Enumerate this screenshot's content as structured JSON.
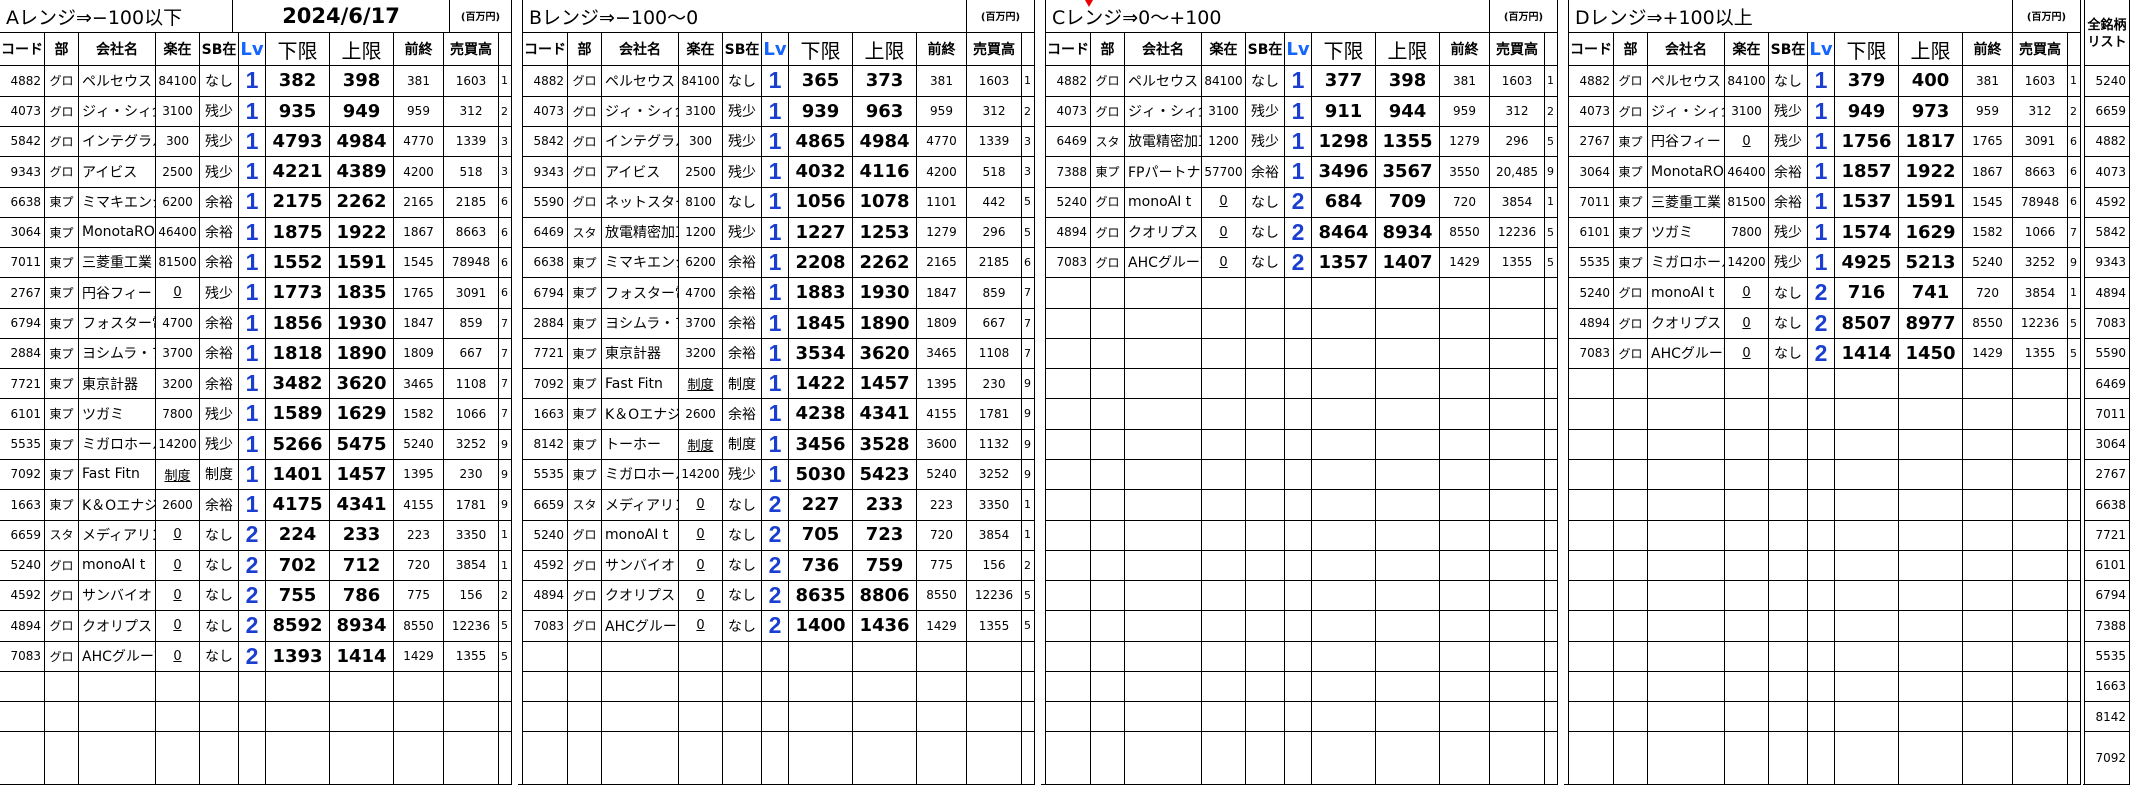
{
  "date": "2024/6/17",
  "unit_label": "(百万円)",
  "headers": {
    "code": "コード",
    "section": "部",
    "company": "会社名",
    "rakuzai": "楽在",
    "sb": "SB在",
    "lv": "Lv",
    "lower": "下限",
    "upper": "上限",
    "prev": "前終",
    "sales": "売買高"
  },
  "all_list": {
    "header": "全銘柄リスト",
    "codes": [
      "5240",
      "6659",
      "4882",
      "4073",
      "4592",
      "5842",
      "9343",
      "4894",
      "7083",
      "5590",
      "6469",
      "7011",
      "3064",
      "2767",
      "6638",
      "7721",
      "6101",
      "6794",
      "7388",
      "5535",
      "1663",
      "8142",
      "7092"
    ]
  },
  "sections": [
    {
      "title": "Aレンジ⇒−100以下",
      "rows": [
        {
          "code": "4882",
          "sec": "グロ",
          "name": "ペルセウス",
          "rak": "84100",
          "sb": "なし",
          "lv": "1",
          "lo": "382",
          "hi": "398",
          "prev": "381",
          "sales": "1603",
          "r": "1"
        },
        {
          "code": "4073",
          "sec": "グロ",
          "name": "ジィ・シィ企",
          "rak": "3100",
          "sb": "残少",
          "lv": "1",
          "lo": "935",
          "hi": "949",
          "prev": "959",
          "sales": "312",
          "r": "2"
        },
        {
          "code": "5842",
          "sec": "グロ",
          "name": "インテグラル",
          "rak": "300",
          "sb": "残少",
          "lv": "1",
          "lo": "4793",
          "hi": "4984",
          "prev": "4770",
          "sales": "1339",
          "r": "3"
        },
        {
          "code": "9343",
          "sec": "グロ",
          "name": "アイビス",
          "rak": "2500",
          "sb": "残少",
          "lv": "1",
          "lo": "4221",
          "hi": "4389",
          "prev": "4200",
          "sales": "518",
          "r": "3"
        },
        {
          "code": "6638",
          "sec": "東プ",
          "name": "ミマキエンジ",
          "rak": "6200",
          "sb": "余裕",
          "lv": "1",
          "lo": "2175",
          "hi": "2262",
          "prev": "2165",
          "sales": "2185",
          "r": "6"
        },
        {
          "code": "3064",
          "sec": "東プ",
          "name": "MonotaRO",
          "rak": "46400",
          "sb": "余裕",
          "lv": "1",
          "lo": "1875",
          "hi": "1922",
          "prev": "1867",
          "sales": "8663",
          "r": "6"
        },
        {
          "code": "7011",
          "sec": "東プ",
          "name": "三菱重工業",
          "rak": "81500",
          "sb": "余裕",
          "lv": "1",
          "lo": "1552",
          "hi": "1591",
          "prev": "1545",
          "sales": "78948",
          "r": "6"
        },
        {
          "code": "2767",
          "sec": "東プ",
          "name": "円谷フィー",
          "rak": "0",
          "u": true,
          "sb": "残少",
          "lv": "1",
          "lo": "1773",
          "hi": "1835",
          "prev": "1765",
          "sales": "3091",
          "r": "6"
        },
        {
          "code": "6794",
          "sec": "東プ",
          "name": "フォスター電",
          "rak": "4700",
          "sb": "余裕",
          "lv": "1",
          "lo": "1856",
          "hi": "1930",
          "prev": "1847",
          "sales": "859",
          "r": "7"
        },
        {
          "code": "2884",
          "sec": "東プ",
          "name": "ヨシムラ・フ",
          "rak": "3700",
          "sb": "余裕",
          "lv": "1",
          "lo": "1818",
          "hi": "1890",
          "prev": "1809",
          "sales": "667",
          "r": "7"
        },
        {
          "code": "7721",
          "sec": "東プ",
          "name": "東京計器",
          "rak": "3200",
          "sb": "余裕",
          "lv": "1",
          "lo": "3482",
          "hi": "3620",
          "prev": "3465",
          "sales": "1108",
          "r": "7"
        },
        {
          "code": "6101",
          "sec": "東プ",
          "name": "ツガミ",
          "rak": "7800",
          "sb": "残少",
          "lv": "1",
          "lo": "1589",
          "hi": "1629",
          "prev": "1582",
          "sales": "1066",
          "r": "7"
        },
        {
          "code": "5535",
          "sec": "東プ",
          "name": "ミガロホール",
          "rak": "14200",
          "sb": "残少",
          "lv": "1",
          "lo": "5266",
          "hi": "5475",
          "prev": "5240",
          "sales": "3252",
          "r": "9"
        },
        {
          "code": "7092",
          "sec": "東プ",
          "name": "Fast Fitn",
          "rak": "制度",
          "u": true,
          "sb": "制度",
          "lv": "1",
          "lo": "1401",
          "hi": "1457",
          "prev": "1395",
          "sales": "230",
          "r": "9"
        },
        {
          "code": "1663",
          "sec": "東プ",
          "name": "K＆Oエナジ",
          "rak": "2600",
          "sb": "余裕",
          "lv": "1",
          "lo": "4175",
          "hi": "4341",
          "prev": "4155",
          "sales": "1781",
          "r": "9"
        },
        {
          "code": "6659",
          "sec": "スタ",
          "name": "メディアリンク",
          "rak": "0",
          "u": true,
          "sb": "なし",
          "lv": "2",
          "lo": "224",
          "hi": "233",
          "prev": "223",
          "sales": "3350",
          "r": "1"
        },
        {
          "code": "5240",
          "sec": "グロ",
          "name": "monoAI t",
          "rak": "0",
          "u": true,
          "sb": "なし",
          "lv": "2",
          "lo": "702",
          "hi": "712",
          "prev": "720",
          "sales": "3854",
          "r": "1"
        },
        {
          "code": "4592",
          "sec": "グロ",
          "name": "サンバイオ",
          "rak": "0",
          "u": true,
          "sb": "なし",
          "lv": "2",
          "lo": "755",
          "hi": "786",
          "prev": "775",
          "sales": "156",
          "r": "2"
        },
        {
          "code": "4894",
          "sec": "グロ",
          "name": "クオリプス",
          "rak": "0",
          "u": true,
          "sb": "なし",
          "lv": "2",
          "lo": "8592",
          "hi": "8934",
          "prev": "8550",
          "sales": "12236",
          "r": "5"
        },
        {
          "code": "7083",
          "sec": "グロ",
          "name": "AHCグループ",
          "rak": "0",
          "u": true,
          "sb": "なし",
          "lv": "2",
          "lo": "1393",
          "hi": "1414",
          "prev": "1429",
          "sales": "1355",
          "r": "5"
        }
      ]
    },
    {
      "title": "Bレンジ⇒−100〜0",
      "rows": [
        {
          "code": "4882",
          "sec": "グロ",
          "name": "ペルセウス",
          "rak": "84100",
          "sb": "なし",
          "lv": "1",
          "lo": "365",
          "hi": "373",
          "prev": "381",
          "sales": "1603",
          "r": "1"
        },
        {
          "code": "4073",
          "sec": "グロ",
          "name": "ジィ・シィ企",
          "rak": "3100",
          "sb": "残少",
          "lv": "1",
          "lo": "939",
          "hi": "963",
          "prev": "959",
          "sales": "312",
          "r": "2"
        },
        {
          "code": "5842",
          "sec": "グロ",
          "name": "インテグラル",
          "rak": "300",
          "sb": "残少",
          "lv": "1",
          "lo": "4865",
          "hi": "4984",
          "prev": "4770",
          "sales": "1339",
          "r": "3"
        },
        {
          "code": "9343",
          "sec": "グロ",
          "name": "アイビス",
          "rak": "2500",
          "sb": "残少",
          "lv": "1",
          "lo": "4032",
          "hi": "4116",
          "prev": "4200",
          "sales": "518",
          "r": "3"
        },
        {
          "code": "5590",
          "sec": "グロ",
          "name": "ネットスター",
          "rak": "8100",
          "sb": "なし",
          "lv": "1",
          "lo": "1056",
          "hi": "1078",
          "prev": "1101",
          "sales": "442",
          "r": "5"
        },
        {
          "code": "6469",
          "sec": "スタ",
          "name": "放電精密加工",
          "rak": "1200",
          "sb": "残少",
          "lv": "1",
          "lo": "1227",
          "hi": "1253",
          "prev": "1279",
          "sales": "296",
          "r": "5"
        },
        {
          "code": "6638",
          "sec": "東プ",
          "name": "ミマキエンジ",
          "rak": "6200",
          "sb": "余裕",
          "lv": "1",
          "lo": "2208",
          "hi": "2262",
          "prev": "2165",
          "sales": "2185",
          "r": "6"
        },
        {
          "code": "6794",
          "sec": "東プ",
          "name": "フォスター電",
          "rak": "4700",
          "sb": "余裕",
          "lv": "1",
          "lo": "1883",
          "hi": "1930",
          "prev": "1847",
          "sales": "859",
          "r": "7"
        },
        {
          "code": "2884",
          "sec": "東プ",
          "name": "ヨシムラ・フ",
          "rak": "3700",
          "sb": "余裕",
          "lv": "1",
          "lo": "1845",
          "hi": "1890",
          "prev": "1809",
          "sales": "667",
          "r": "7"
        },
        {
          "code": "7721",
          "sec": "東プ",
          "name": "東京計器",
          "rak": "3200",
          "sb": "余裕",
          "lv": "1",
          "lo": "3534",
          "hi": "3620",
          "prev": "3465",
          "sales": "1108",
          "r": "7"
        },
        {
          "code": "7092",
          "sec": "東プ",
          "name": "Fast Fitn",
          "rak": "制度",
          "u": true,
          "sb": "制度",
          "lv": "1",
          "lo": "1422",
          "hi": "1457",
          "prev": "1395",
          "sales": "230",
          "r": "9"
        },
        {
          "code": "1663",
          "sec": "東プ",
          "name": "K＆Oエナジ",
          "rak": "2600",
          "sb": "余裕",
          "lv": "1",
          "lo": "4238",
          "hi": "4341",
          "prev": "4155",
          "sales": "1781",
          "r": "9"
        },
        {
          "code": "8142",
          "sec": "東プ",
          "name": "トーホー",
          "rak": "制度",
          "u": true,
          "sb": "制度",
          "lv": "1",
          "lo": "3456",
          "hi": "3528",
          "prev": "3600",
          "sales": "1132",
          "r": "9"
        },
        {
          "code": "5535",
          "sec": "東プ",
          "name": "ミガロホール",
          "rak": "14200",
          "sb": "残少",
          "lv": "1",
          "lo": "5030",
          "hi": "5423",
          "prev": "5240",
          "sales": "3252",
          "r": "9"
        },
        {
          "code": "6659",
          "sec": "スタ",
          "name": "メディアリンク",
          "rak": "0",
          "u": true,
          "sb": "なし",
          "lv": "2",
          "lo": "227",
          "hi": "233",
          "prev": "223",
          "sales": "3350",
          "r": "1"
        },
        {
          "code": "5240",
          "sec": "グロ",
          "name": "monoAI t",
          "rak": "0",
          "u": true,
          "sb": "なし",
          "lv": "2",
          "lo": "705",
          "hi": "723",
          "prev": "720",
          "sales": "3854",
          "r": "1"
        },
        {
          "code": "4592",
          "sec": "グロ",
          "name": "サンバイオ",
          "rak": "0",
          "u": true,
          "sb": "なし",
          "lv": "2",
          "lo": "736",
          "hi": "759",
          "prev": "775",
          "sales": "156",
          "r": "2"
        },
        {
          "code": "4894",
          "sec": "グロ",
          "name": "クオリプス",
          "rak": "0",
          "u": true,
          "sb": "なし",
          "lv": "2",
          "lo": "8635",
          "hi": "8806",
          "prev": "8550",
          "sales": "12236",
          "r": "5"
        },
        {
          "code": "7083",
          "sec": "グロ",
          "name": "AHCグループ",
          "rak": "0",
          "u": true,
          "sb": "なし",
          "lv": "2",
          "lo": "1400",
          "hi": "1436",
          "prev": "1429",
          "sales": "1355",
          "r": "5"
        }
      ]
    },
    {
      "title": "Cレンジ⇒0〜+100",
      "rows": [
        {
          "code": "4882",
          "sec": "グロ",
          "name": "ペルセウス",
          "rak": "84100",
          "sb": "なし",
          "lv": "1",
          "lo": "377",
          "hi": "398",
          "prev": "381",
          "sales": "1603",
          "r": "1"
        },
        {
          "code": "4073",
          "sec": "グロ",
          "name": "ジィ・シィ企",
          "rak": "3100",
          "sb": "残少",
          "lv": "1",
          "lo": "911",
          "hi": "944",
          "prev": "959",
          "sales": "312",
          "r": "2"
        },
        {
          "code": "6469",
          "sec": "スタ",
          "name": "放電精密加工",
          "rak": "1200",
          "sb": "残少",
          "lv": "1",
          "lo": "1298",
          "hi": "1355",
          "prev": "1279",
          "sales": "296",
          "r": "5"
        },
        {
          "code": "7388",
          "sec": "東プ",
          "name": "FPパートナー",
          "rak": "57700",
          "sb": "余裕",
          "lv": "1",
          "lo": "3496",
          "hi": "3567",
          "prev": "3550",
          "sales": "20,485",
          "r": "9"
        },
        {
          "code": "5240",
          "sec": "グロ",
          "name": "monoAI t",
          "rak": "0",
          "u": true,
          "sb": "なし",
          "lv": "2",
          "lo": "684",
          "hi": "709",
          "prev": "720",
          "sales": "3854",
          "r": "1"
        },
        {
          "code": "4894",
          "sec": "グロ",
          "name": "クオリプス",
          "rak": "0",
          "u": true,
          "sb": "なし",
          "lv": "2",
          "lo": "8464",
          "hi": "8934",
          "prev": "8550",
          "sales": "12236",
          "r": "5"
        },
        {
          "code": "7083",
          "sec": "グロ",
          "name": "AHCグループ",
          "rak": "0",
          "u": true,
          "sb": "なし",
          "lv": "2",
          "lo": "1357",
          "hi": "1407",
          "prev": "1429",
          "sales": "1355",
          "r": "5"
        }
      ]
    },
    {
      "title": "Dレンジ⇒+100以上",
      "rows": [
        {
          "code": "4882",
          "sec": "グロ",
          "name": "ペルセウス",
          "rak": "84100",
          "sb": "なし",
          "lv": "1",
          "lo": "379",
          "hi": "400",
          "prev": "381",
          "sales": "1603",
          "r": "1"
        },
        {
          "code": "4073",
          "sec": "グロ",
          "name": "ジィ・シィ企",
          "rak": "3100",
          "sb": "残少",
          "lv": "1",
          "lo": "949",
          "hi": "973",
          "prev": "959",
          "sales": "312",
          "r": "2"
        },
        {
          "code": "2767",
          "sec": "東プ",
          "name": "円谷フィー",
          "rak": "0",
          "u": true,
          "sb": "残少",
          "lv": "1",
          "lo": "1756",
          "hi": "1817",
          "prev": "1765",
          "sales": "3091",
          "r": "6"
        },
        {
          "code": "3064",
          "sec": "東プ",
          "name": "MonotaRO",
          "rak": "46400",
          "sb": "余裕",
          "lv": "1",
          "lo": "1857",
          "hi": "1922",
          "prev": "1867",
          "sales": "8663",
          "r": "6"
        },
        {
          "code": "7011",
          "sec": "東プ",
          "name": "三菱重工業",
          "rak": "81500",
          "sb": "余裕",
          "lv": "1",
          "lo": "1537",
          "hi": "1591",
          "prev": "1545",
          "sales": "78948",
          "r": "6"
        },
        {
          "code": "6101",
          "sec": "東プ",
          "name": "ツガミ",
          "rak": "7800",
          "sb": "残少",
          "lv": "1",
          "lo": "1574",
          "hi": "1629",
          "prev": "1582",
          "sales": "1066",
          "r": "7"
        },
        {
          "code": "5535",
          "sec": "東プ",
          "name": "ミガロホール",
          "rak": "14200",
          "sb": "残少",
          "lv": "1",
          "lo": "4925",
          "hi": "5213",
          "prev": "5240",
          "sales": "3252",
          "r": "9"
        },
        {
          "code": "5240",
          "sec": "グロ",
          "name": "monoAI t",
          "rak": "0",
          "u": true,
          "sb": "なし",
          "lv": "2",
          "lo": "716",
          "hi": "741",
          "prev": "720",
          "sales": "3854",
          "r": "1"
        },
        {
          "code": "4894",
          "sec": "グロ",
          "name": "クオリプス",
          "rak": "0",
          "u": true,
          "sb": "なし",
          "lv": "2",
          "lo": "8507",
          "hi": "8977",
          "prev": "8550",
          "sales": "12236",
          "r": "5"
        },
        {
          "code": "7083",
          "sec": "グロ",
          "name": "AHCグループ",
          "rak": "0",
          "u": true,
          "sb": "なし",
          "lv": "2",
          "lo": "1414",
          "hi": "1450",
          "prev": "1429",
          "sales": "1355",
          "r": "5"
        }
      ]
    }
  ]
}
